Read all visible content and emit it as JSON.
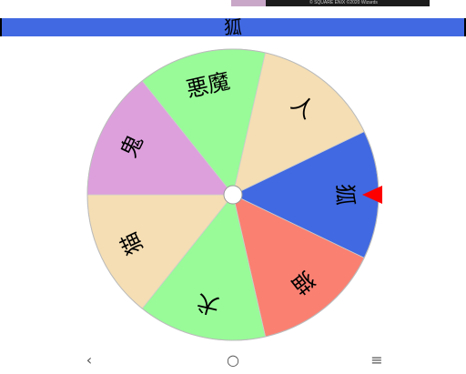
{
  "ad": {
    "caption": "© SQUARE ENIX ©2020 Wizards"
  },
  "header": {
    "result": "狐"
  },
  "wheel": {
    "segments": [
      {
        "label": "狐",
        "color": "#4169e1"
      },
      {
        "label": "猫",
        "color": "#fa8072"
      },
      {
        "label": "犬",
        "color": "#98fb98"
      },
      {
        "label": "猫",
        "color": "#f5deb3"
      },
      {
        "label": "鬼",
        "color": "#dda0dd"
      },
      {
        "label": "悪魔",
        "color": "#98fb98"
      },
      {
        "label": "人",
        "color": "#f5deb3"
      }
    ],
    "pointer_color": "#ff0000"
  },
  "nav": {
    "back": "‹",
    "home": "○",
    "menu": "≡"
  }
}
